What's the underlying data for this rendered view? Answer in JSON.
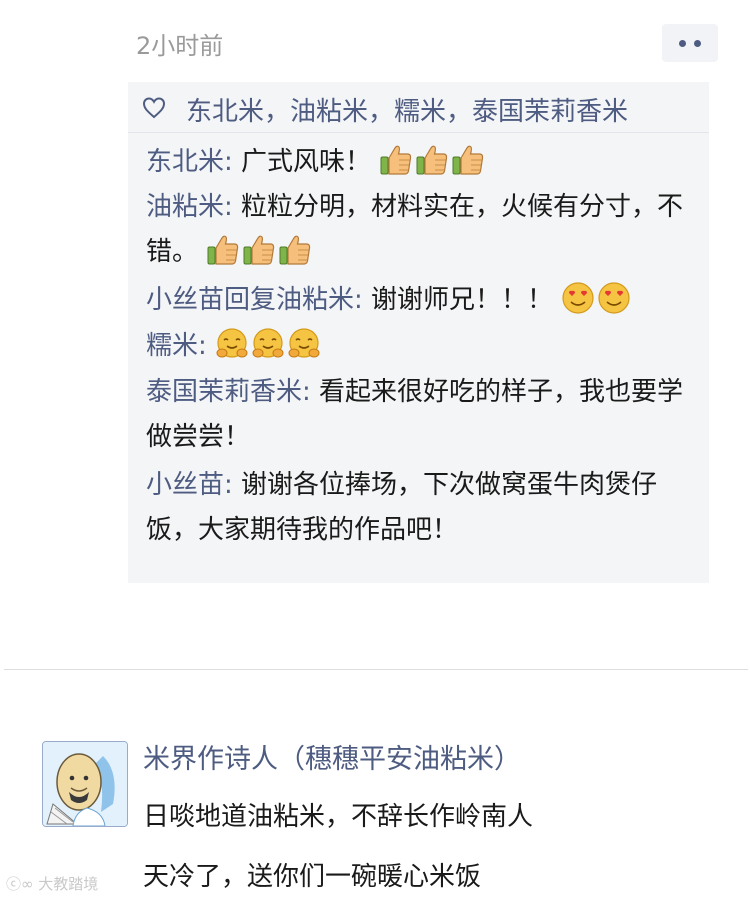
{
  "post": {
    "timestamp": "2小时前",
    "more_icon": "more-dots-icon",
    "likes_icon": "heart-outline-icon",
    "likes_names": "东北米，油粘米，糯米，泰国茉莉香米",
    "comments": [
      {
        "author": "东北米:",
        "text": "广式风味！",
        "emoji": "thumbs-up",
        "emoji_count": 3
      },
      {
        "author": "油粘米:",
        "text": "粒粒分明，材料实在，火候有分寸，不错。",
        "emoji": "thumbs-up",
        "emoji_count": 3
      },
      {
        "author": "小丝苗回复油粘米:",
        "text": "谢谢师兄！！！",
        "emoji": "heart-eyes",
        "emoji_count": 2
      },
      {
        "author": "糯米:",
        "text": "",
        "emoji": "hugging-face",
        "emoji_count": 3
      },
      {
        "author": "泰国茉莉香米:",
        "text": "看起来很好吃的样子，我也要学做尝尝！",
        "emoji": "",
        "emoji_count": 0
      },
      {
        "author": "小丝苗:",
        "text": "谢谢各位捧场，下次做窝蛋牛肉煲仔饭，大家期待我的作品吧！",
        "emoji": "",
        "emoji_count": 0
      }
    ]
  },
  "next_post": {
    "author_name": "米界作诗人（穗穗平安油粘米）",
    "avatar_icon": "cartoon-rice-poet-avatar",
    "lines": [
      "日啖地道油粘米，不辞长作岭南人",
      "天冷了，送你们一碗暖心米饭"
    ]
  },
  "watermark": "大教踏境",
  "colors": {
    "link_blue": "#4e5c82",
    "panel_bg": "#f4f5f7",
    "timestamp_gray": "#9a9a9a"
  }
}
